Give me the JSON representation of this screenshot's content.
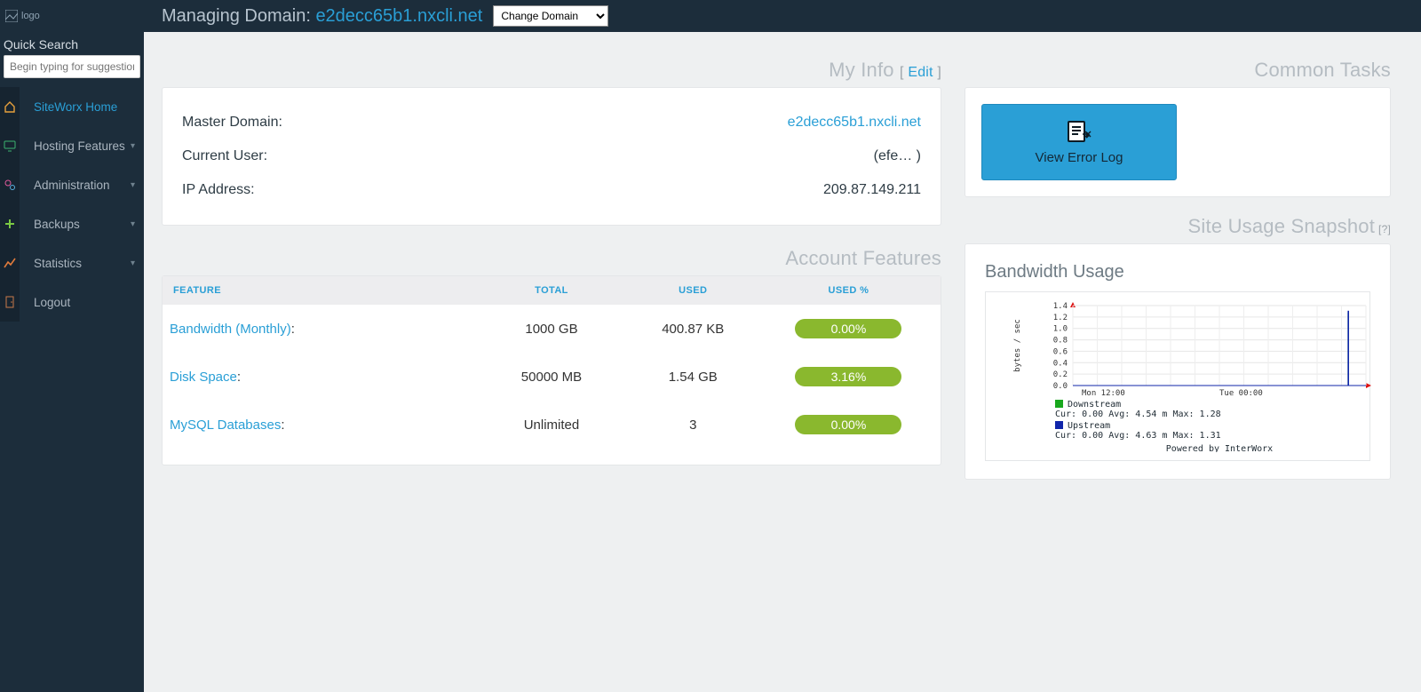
{
  "top": {
    "logo_alt": "logo",
    "label": "Managing Domain:",
    "domain": "e2decc65b1.nxcli.net",
    "change_domain": "Change Domain"
  },
  "sidebar": {
    "quick_search_label": "Quick Search",
    "quick_search_placeholder": "Begin typing for suggestions",
    "items": [
      {
        "label": "SiteWorx Home",
        "icon": "home",
        "expandable": false,
        "active": true
      },
      {
        "label": "Hosting Features",
        "icon": "monitor",
        "expandable": true,
        "active": false
      },
      {
        "label": "Administration",
        "icon": "cogs",
        "expandable": true,
        "active": false
      },
      {
        "label": "Backups",
        "icon": "plus",
        "expandable": true,
        "active": false
      },
      {
        "label": "Statistics",
        "icon": "chart",
        "expandable": true,
        "active": false
      },
      {
        "label": "Logout",
        "icon": "door",
        "expandable": false,
        "active": false
      }
    ]
  },
  "myinfo": {
    "title": "My Info",
    "edit": "Edit",
    "master_domain_k": "Master Domain:",
    "master_domain_v": "e2decc65b1.nxcli.net",
    "current_user_k": "Current User:",
    "current_user_v": "(efe…                                            )",
    "ip_k": "IP Address:",
    "ip_v": "209.87.149.211"
  },
  "features": {
    "title": "Account Features",
    "head": {
      "feature": "FEATURE",
      "total": "TOTAL",
      "used": "USED",
      "usedpct": "USED %"
    },
    "rows": [
      {
        "name": "Bandwidth (Monthly)",
        "total": "1000 GB",
        "used": "400.87 KB",
        "pct": "0.00%"
      },
      {
        "name": "Disk Space",
        "total": "50000 MB",
        "used": "1.54 GB",
        "pct": "3.16%"
      },
      {
        "name": "MySQL Databases",
        "total": "Unlimited",
        "used": "3",
        "pct": "0.00%"
      }
    ]
  },
  "tasks": {
    "title": "Common Tasks",
    "view_error_log": "View Error Log"
  },
  "snapshot": {
    "title": "Site Usage Snapshot",
    "help": "[?]",
    "bw_title": "Bandwidth Usage"
  },
  "chart_data": {
    "type": "line",
    "ylabel": "bytes / sec",
    "ylim": [
      0,
      1.4
    ],
    "yticks": [
      0.0,
      0.2,
      0.4,
      0.6,
      0.8,
      1.0,
      1.2,
      1.4
    ],
    "xticks": [
      "Mon 12:00",
      "Tue 00:00"
    ],
    "series": [
      {
        "name": "Downstream",
        "color": "#19a81e",
        "cur": 0.0,
        "avg": "4.54 m",
        "max": 1.28
      },
      {
        "name": "Upstream",
        "color": "#1025aa",
        "cur": 0.0,
        "avg": "4.63 m",
        "max": 1.31
      }
    ],
    "spike_x_frac": 0.94,
    "footer": "Powered by InterWorx"
  }
}
